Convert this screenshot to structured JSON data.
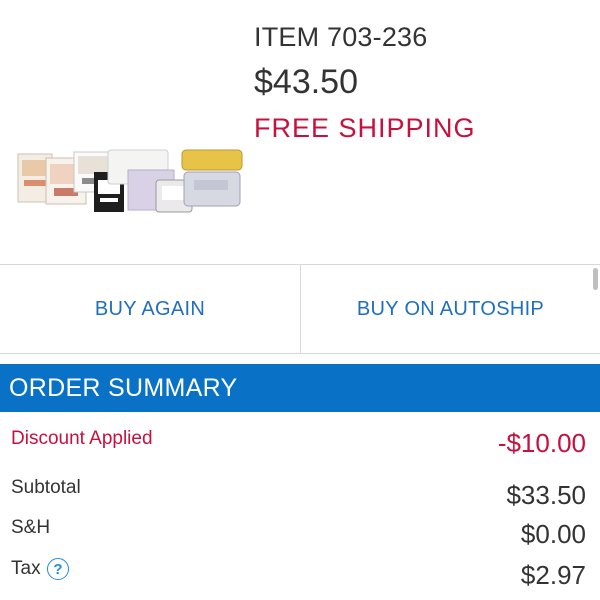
{
  "product": {
    "item_number": "ITEM 703-236",
    "price": "$43.50",
    "shipping": "FREE SHIPPING",
    "image_icon": "product-set-image"
  },
  "actions": {
    "buy_again": "BUY AGAIN",
    "buy_autoship": "BUY ON AUTOSHIP"
  },
  "summary": {
    "title": "ORDER SUMMARY",
    "rows": [
      {
        "label": "Discount Applied",
        "value": "-$10.00"
      },
      {
        "label": "Subtotal",
        "value": "$33.50"
      },
      {
        "label": "S&H",
        "value": "$0.00"
      },
      {
        "label": "Tax",
        "value": "$2.97"
      }
    ],
    "help_glyph": "?"
  },
  "colors": {
    "accent_blue": "#0a72c6",
    "link_blue": "#1f6fc1",
    "alert_red": "#c8103e"
  }
}
